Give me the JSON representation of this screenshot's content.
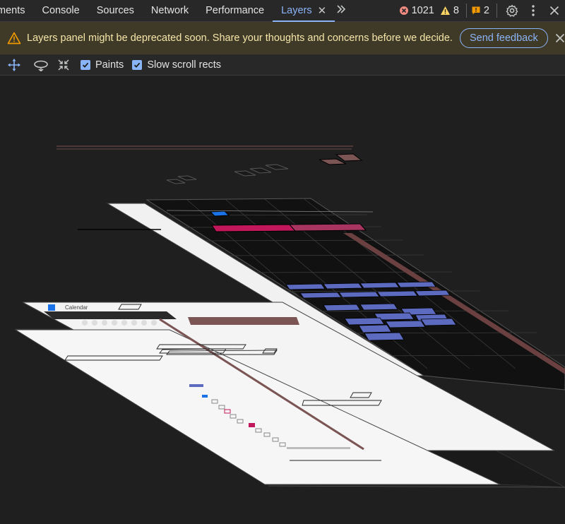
{
  "tabs": {
    "items": [
      {
        "label": "ments"
      },
      {
        "label": "Console"
      },
      {
        "label": "Sources"
      },
      {
        "label": "Network"
      },
      {
        "label": "Performance"
      },
      {
        "label": "Layers"
      }
    ],
    "more_icon": "chevron-double-right-icon"
  },
  "status": {
    "errors": "1021",
    "warnings": "8",
    "issues": "2",
    "colors": {
      "error": "#f28b82",
      "warning": "#fdd663",
      "issue": "#f29900"
    }
  },
  "banner": {
    "message": "Layers panel might be deprecated soon. Share your thoughts and concerns before we decide.",
    "feedback_label": "Send feedback"
  },
  "toolbar": {
    "paints_label": "Paints",
    "paints_checked": true,
    "slow_scroll_label": "Slow scroll rects",
    "slow_scroll_checked": true
  },
  "layers": {
    "mini_labels": [
      "Tuesday 11",
      "Tuesday 11",
      "Tuesday 11",
      "Tuesday 11"
    ],
    "page_title_fragment": "Calendar",
    "colors": {
      "accent": "#8ab4f8",
      "layer_blue": "#5c6bc0",
      "layer_pink": "#c2185b",
      "layer_brown": "#7b5454"
    }
  }
}
